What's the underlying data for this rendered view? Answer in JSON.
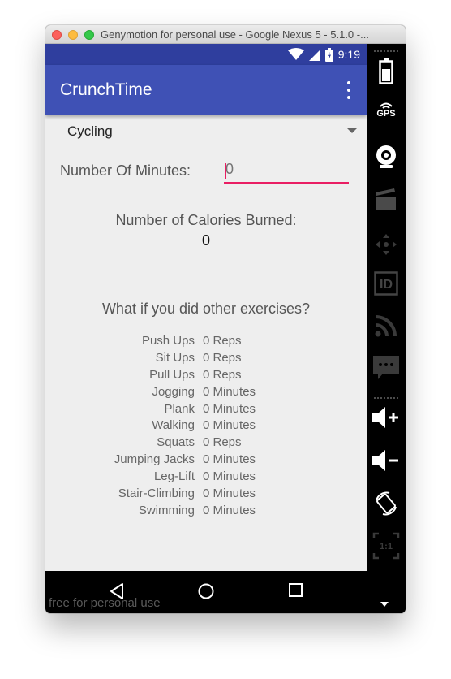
{
  "window": {
    "title": "Genymotion for personal use - Google Nexus 5 - 5.1.0 -..."
  },
  "status_bar": {
    "time": "9:19"
  },
  "app_bar": {
    "title": "CrunchTime"
  },
  "spinner": {
    "selected": "Cycling"
  },
  "minutes": {
    "label": "Number Of Minutes:",
    "value": "0"
  },
  "calories": {
    "label": "Number of Calories Burned:",
    "value": "0"
  },
  "what_if": {
    "heading": "What if you did other exercises?"
  },
  "exercises": [
    {
      "name": "Push Ups",
      "value": "0 Reps"
    },
    {
      "name": "Sit Ups",
      "value": "0 Reps"
    },
    {
      "name": "Pull Ups",
      "value": "0 Reps"
    },
    {
      "name": "Jogging",
      "value": "0 Minutes"
    },
    {
      "name": "Plank",
      "value": "0 Minutes"
    },
    {
      "name": "Walking",
      "value": "0 Minutes"
    },
    {
      "name": "Squats",
      "value": "0 Reps"
    },
    {
      "name": "Jumping Jacks",
      "value": "0 Minutes"
    },
    {
      "name": "Leg-Lift",
      "value": "0 Minutes"
    },
    {
      "name": "Stair-Climbing",
      "value": "0 Minutes"
    },
    {
      "name": "Swimming",
      "value": "0 Minutes"
    }
  ],
  "watermark": "free for personal use",
  "sidebar": {
    "gps_label": "GPS",
    "id_label": "ID",
    "scale_label": "1:1"
  },
  "colors": {
    "app_bar": "#3f51b5",
    "status_bar": "#2f3e9e",
    "accent": "#e91e63",
    "background": "#eeeeee"
  },
  "icons": [
    "battery-icon",
    "gps-icon",
    "webcam-icon",
    "video-capture-icon",
    "remote-control-icon",
    "identifiers-icon",
    "rss-icon",
    "sms-icon",
    "volume-up-icon",
    "volume-down-icon",
    "rotate-icon",
    "pixel-perfect-icon",
    "back-icon",
    "home-icon",
    "recents-icon"
  ]
}
